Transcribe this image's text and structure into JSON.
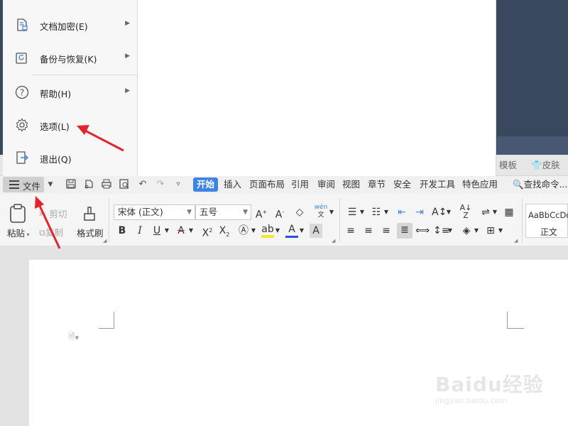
{
  "file_menu": {
    "items": [
      {
        "label": "文档加密(E)",
        "icon": "document-lock-icon",
        "submenu": true
      },
      {
        "label": "备份与恢复(K)",
        "icon": "backup-restore-icon",
        "submenu": true
      },
      {
        "label": "帮助(H)",
        "icon": "help-icon",
        "submenu": true
      },
      {
        "label": "选项(L)",
        "icon": "gear-icon",
        "submenu": false
      },
      {
        "label": "退出(Q)",
        "icon": "exit-icon",
        "submenu": false
      }
    ]
  },
  "top_tabs": {
    "template": "模板",
    "skin": "皮肤"
  },
  "menubar": {
    "file_label": "文件",
    "tabs": [
      "开始",
      "插入",
      "页面布局",
      "引用",
      "审阅",
      "视图",
      "章节",
      "安全",
      "开发工具",
      "特色应用"
    ],
    "active_tab": "开始",
    "search_label": "查找命令..."
  },
  "ribbon": {
    "paste": "粘贴",
    "cut": "剪切",
    "copy": "复制",
    "format_painter": "格式刷",
    "font_name": "宋体 (正文)",
    "font_size": "五号",
    "phonetic": "wén",
    "style_preview": "AaBbCcDd",
    "style_name": "正文"
  },
  "watermark": {
    "brand": "Baidu经验",
    "url": "jingyan.baidu.com"
  },
  "colors": {
    "accent": "#3e84e6",
    "titlebar": "#39475f",
    "annotation_arrow": "#e0262b"
  }
}
